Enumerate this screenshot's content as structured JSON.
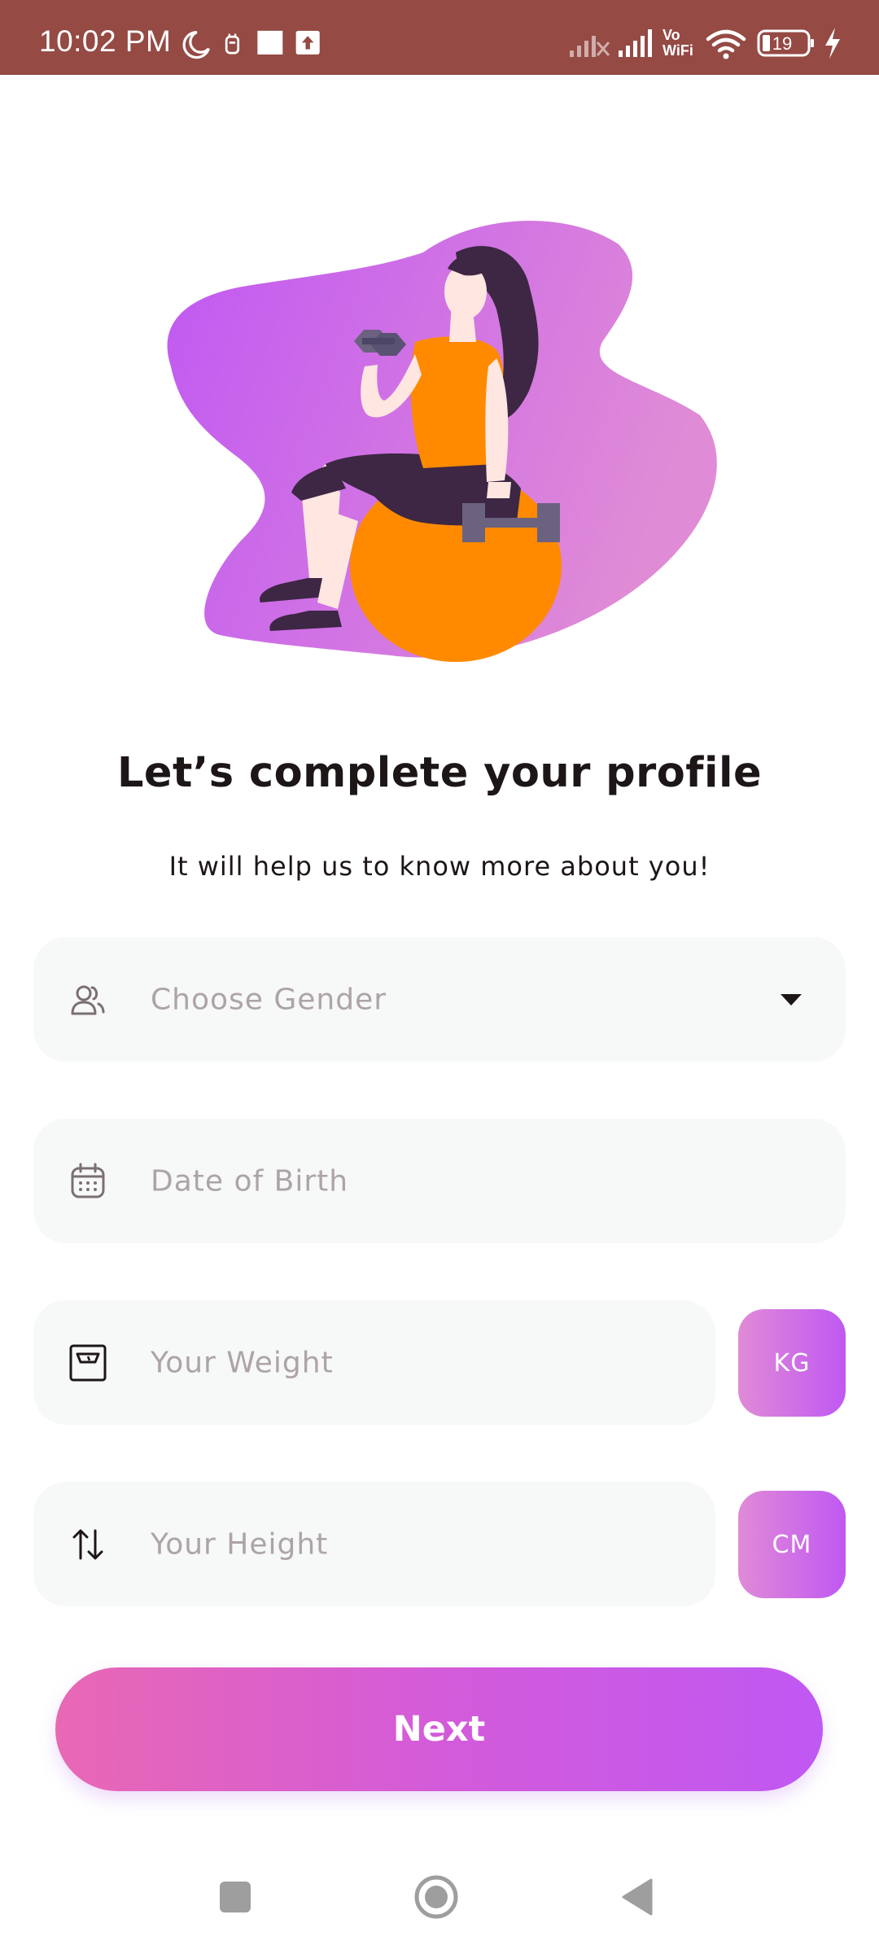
{
  "status_bar": {
    "time": "10:02 PM",
    "vowifi_line1": "Vo",
    "vowifi_line2": "WiFi",
    "battery": "19",
    "icons": [
      "moon-icon",
      "notification-icon",
      "square-icon",
      "upload-icon",
      "signal-off-icon",
      "signal-icon",
      "wifi-icon",
      "battery-icon",
      "charging-icon"
    ]
  },
  "colors": {
    "status_bar": "#954A44",
    "title": "#1D1617",
    "placeholder": "#ADA4A5",
    "field_bg": "#F7F8F8",
    "gradient_start": "#E868B4",
    "gradient_end": "#C058F3"
  },
  "main": {
    "title": "Let’s complete your profile",
    "subtitle": "It will help us to know more about you!",
    "fields": {
      "gender": {
        "placeholder": "Choose Gender",
        "icon": "users-icon"
      },
      "dob": {
        "placeholder": "Date of Birth",
        "icon": "calendar-icon"
      },
      "weight": {
        "placeholder": "Your Weight",
        "icon": "scale-icon",
        "unit": "KG"
      },
      "height": {
        "placeholder": "Your Height",
        "icon": "swap-vertical-icon",
        "unit": "CM"
      }
    },
    "next_label": "Next"
  },
  "nav": {
    "recent": "recent-apps-icon",
    "home": "home-icon",
    "back": "back-icon"
  }
}
